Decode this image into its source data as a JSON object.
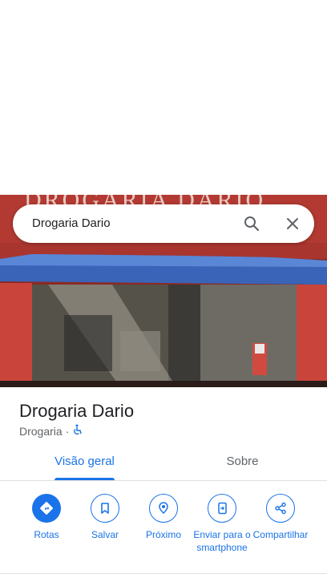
{
  "search": {
    "query": "Drogaria Dario"
  },
  "place": {
    "name": "Drogaria Dario",
    "category": "Drogaria",
    "separator": "·",
    "photo_sign": "DROGARIA DARIO"
  },
  "tabs": [
    {
      "label": "Visão geral",
      "active": true
    },
    {
      "label": "Sobre",
      "active": false
    }
  ],
  "actions": [
    {
      "label": "Rotas",
      "icon": "directions-icon"
    },
    {
      "label": "Salvar",
      "icon": "bookmark-icon"
    },
    {
      "label": "Próximo",
      "icon": "nearby-icon"
    },
    {
      "label": "Enviar para o smartphone",
      "icon": "send-to-phone-icon"
    },
    {
      "label": "Compartilhar",
      "icon": "share-icon"
    }
  ],
  "colors": {
    "accent": "#1a73e8",
    "text": "#202124",
    "secondary": "#5f6368"
  }
}
